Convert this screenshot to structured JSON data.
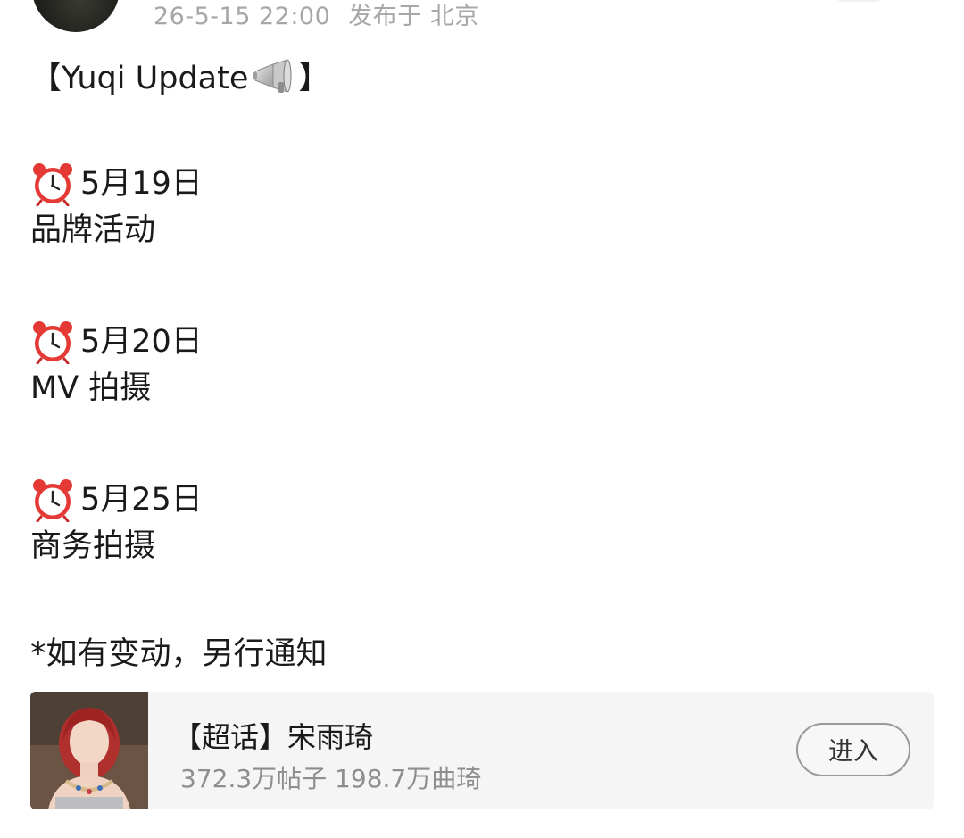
{
  "header": {
    "timestamp": "26-5-15 22:00",
    "location": "发布于 北京"
  },
  "post": {
    "title_prefix": "【Yuqi Update",
    "title_suffix": "】",
    "entries": [
      {
        "date": "5月19日",
        "event": "品牌活动"
      },
      {
        "date": "5月20日",
        "event": "MV 拍摄"
      },
      {
        "date": "5月25日",
        "event": "商务拍摄"
      }
    ],
    "note": "*如有变动，另行通知"
  },
  "topic_card": {
    "title": "【超话】宋雨琦",
    "stats": "372.3万帖子 198.7万曲琦",
    "enter_label": "进入"
  },
  "icons": {
    "megaphone": "megaphone-icon",
    "clock": "alarm-clock-icon"
  },
  "colors": {
    "meta_text": "#a7a7a7",
    "card_bg": "#f5f5f5",
    "clock_red": "#e53935"
  }
}
